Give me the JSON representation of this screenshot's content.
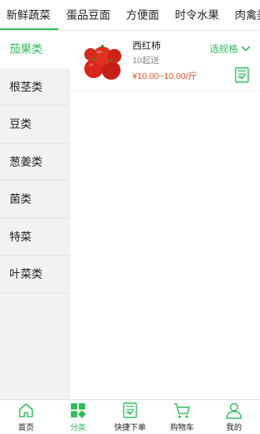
{
  "top_tabs": [
    {
      "label": "新鲜蔬菜"
    },
    {
      "label": "蛋品豆面"
    },
    {
      "label": "方便面"
    },
    {
      "label": "时令水果"
    },
    {
      "label": "肉禽类"
    }
  ],
  "sidebar": {
    "items": [
      {
        "label": "茄果类"
      },
      {
        "label": "根茎类"
      },
      {
        "label": "豆类"
      },
      {
        "label": "葱姜类"
      },
      {
        "label": "菌类"
      },
      {
        "label": "特菜"
      },
      {
        "label": "叶菜类"
      }
    ]
  },
  "products": [
    {
      "name": "西红柿",
      "min_order": "10起送",
      "price": "¥10.00~10.00/斤",
      "spec_label": "选规格"
    }
  ],
  "bottom_nav": [
    {
      "label": "首页"
    },
    {
      "label": "分类"
    },
    {
      "label": "快捷下单"
    },
    {
      "label": "购物车"
    },
    {
      "label": "我的"
    }
  ],
  "colors": {
    "accent": "#2ebd59",
    "price": "#e74c1d"
  }
}
